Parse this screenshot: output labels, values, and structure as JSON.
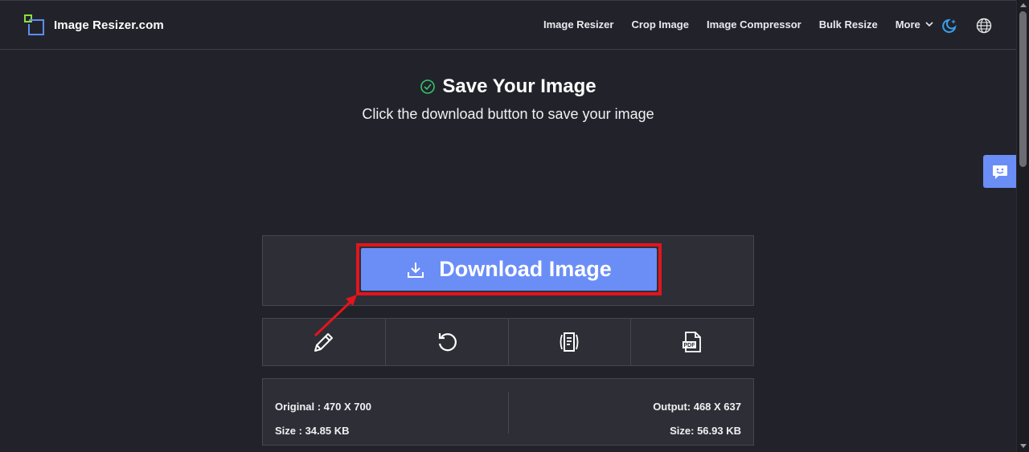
{
  "brand": {
    "name": "Image Resizer.com",
    "icon": "logo-icon"
  },
  "nav": {
    "items": [
      "Image Resizer",
      "Crop Image",
      "Image Compressor",
      "Bulk Resize"
    ],
    "more_label": "More",
    "icons": [
      "moon-icon",
      "globe-icon"
    ]
  },
  "header": {
    "title": "Save Your Image",
    "subtitle": "Click the download button to save your image",
    "title_icon": "check-circle-icon"
  },
  "download": {
    "label": "Download Image",
    "icon": "download-icon"
  },
  "tools": [
    {
      "icon": "pencil-icon"
    },
    {
      "icon": "undo-icon"
    },
    {
      "icon": "document-icon"
    },
    {
      "icon": "pdf-icon"
    }
  ],
  "pdf_icon_text": "PDF",
  "info": {
    "original_label": "Original : 470 X 700",
    "original_size": "Size : 34.85 KB",
    "output_label": "Output: 468 X 637",
    "output_size": "Size: 56.93 KB"
  },
  "colors": {
    "background": "#22232a",
    "panel": "#2e2f36",
    "accent": "#6b8ef6",
    "highlight": "#e3141d",
    "success": "#35c46a"
  }
}
